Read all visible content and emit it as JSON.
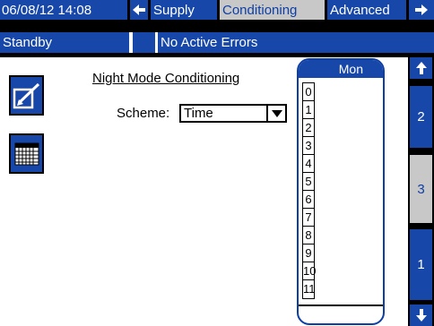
{
  "header": {
    "datetime": "06/08/12 14:08",
    "tabs": [
      {
        "label": "Supply",
        "active": false
      },
      {
        "label": "Conditioning",
        "active": true
      },
      {
        "label": "Advanced",
        "active": false
      }
    ],
    "prev_icon": "arrow-left-icon",
    "next_icon": "arrow-right-icon"
  },
  "status": {
    "mode": "Standby",
    "errors": "No Active Errors"
  },
  "sidebar": {
    "edit_icon": "edit-icon",
    "calendar_icon": "calendar-grid-icon"
  },
  "main": {
    "title": "Night Mode Conditioning",
    "scheme_label": "Scheme:",
    "scheme_value": "Time"
  },
  "calendar": {
    "day": "Mon",
    "hours": [
      "0",
      "1",
      "2",
      "3",
      "4",
      "5",
      "6",
      "7",
      "8",
      "9",
      "10",
      "11"
    ]
  },
  "pages": {
    "up_icon": "arrow-up-icon",
    "down_icon": "arrow-down-icon",
    "tabs": [
      {
        "label": "2",
        "active": false
      },
      {
        "label": "3",
        "active": true
      },
      {
        "label": "1",
        "active": false
      }
    ]
  },
  "colors": {
    "accent": "#1747a8",
    "active_tab": "#c8c8c8",
    "background": "#ffffff"
  }
}
